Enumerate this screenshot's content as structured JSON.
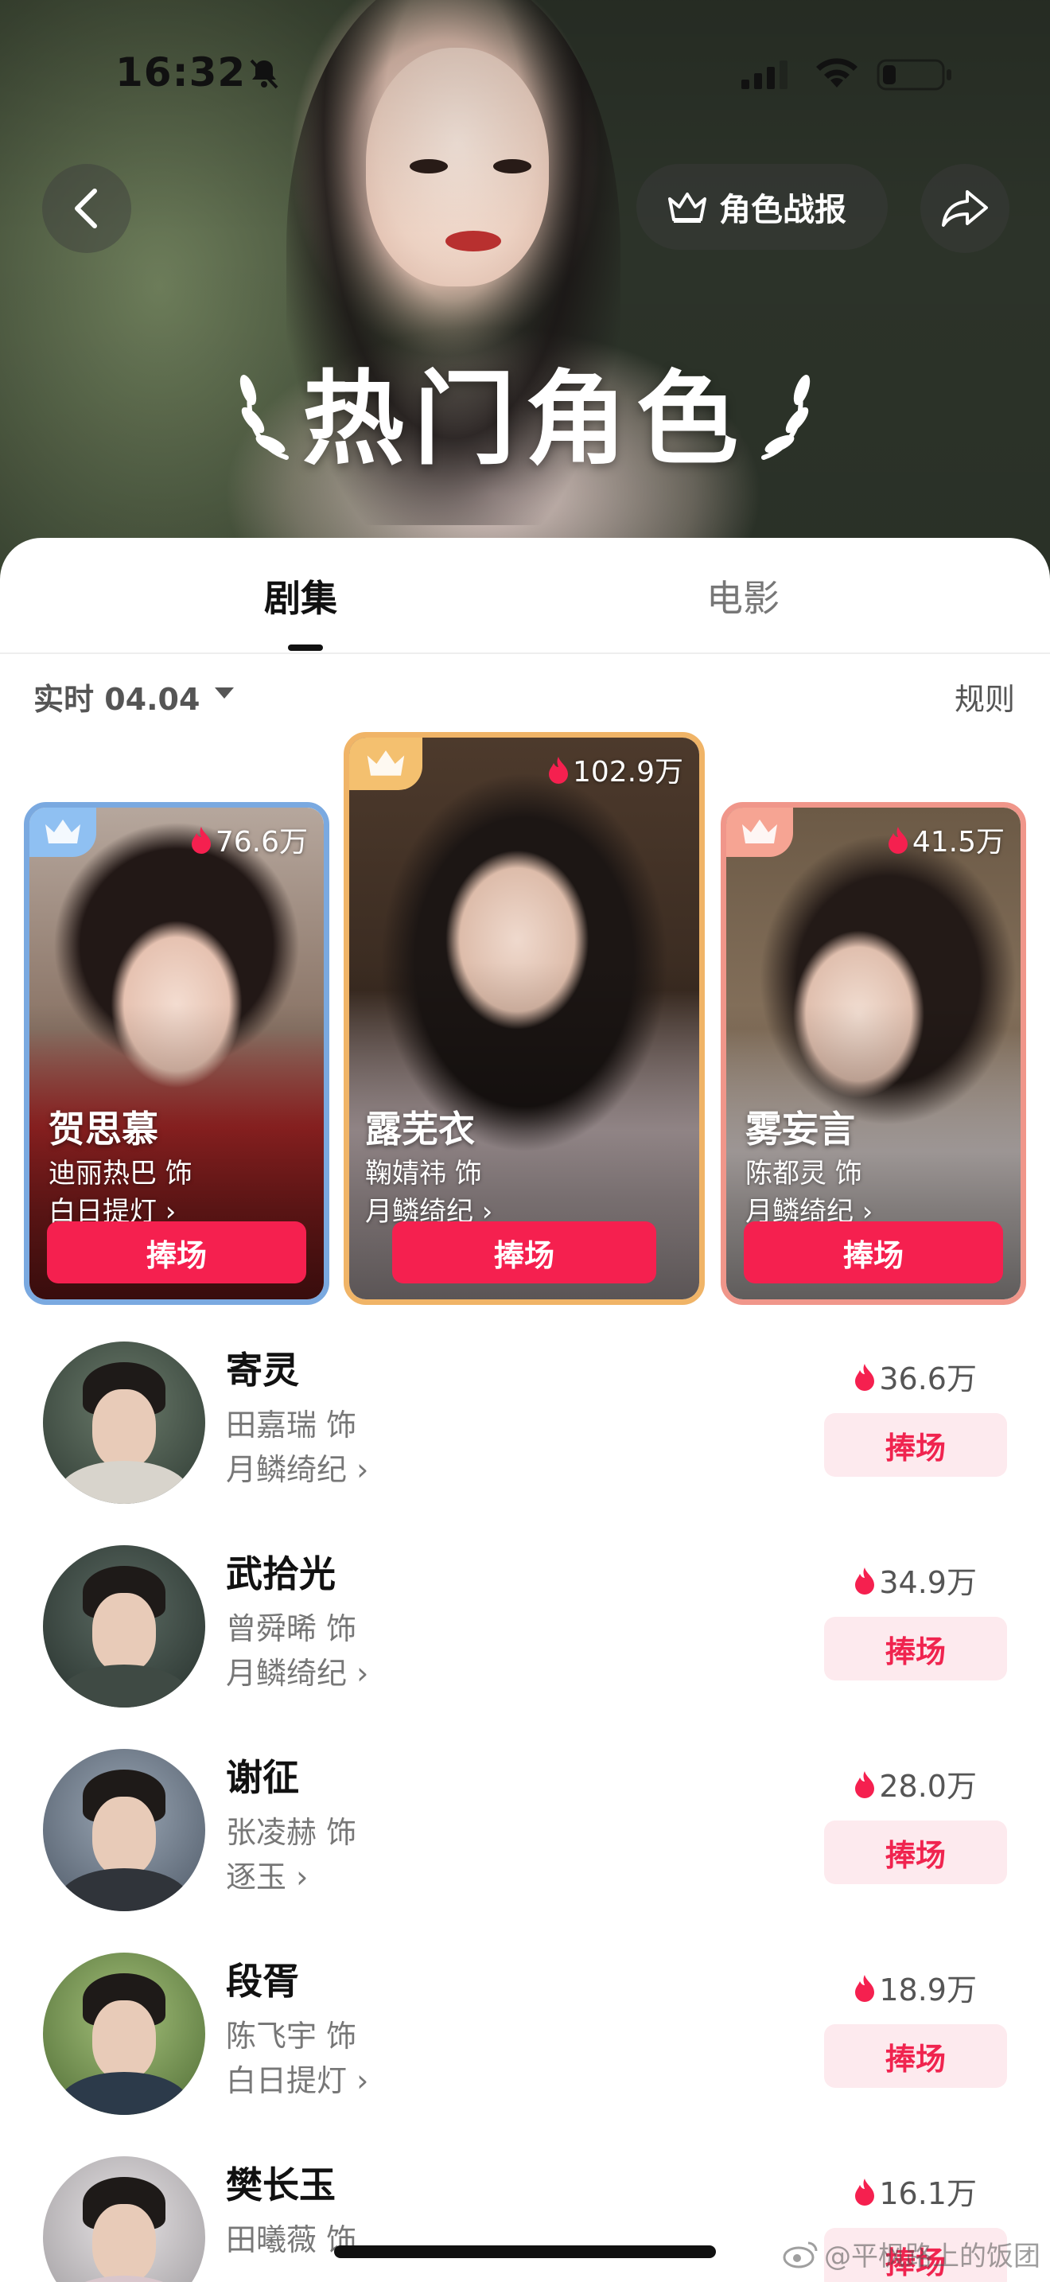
{
  "status_bar": {
    "time": "16:32"
  },
  "header": {
    "report_label": "角色战报",
    "title": "热门角色"
  },
  "tabs": [
    {
      "label": "剧集"
    },
    {
      "label": "电影"
    }
  ],
  "filter": {
    "label": "实时 04.04",
    "rules_label": "规则"
  },
  "colors": {
    "accent": "#f5204f",
    "support_bg": "#fdeaee",
    "rank1_border": "#f0b467",
    "rank2_border": "#7aa9e0",
    "rank3_border": "#f0968a"
  },
  "podium": [
    {
      "name": "贺思慕",
      "actor": "迪丽热巴 饰",
      "show": "白日提灯 ›",
      "heat": "76.6万",
      "support_label": "捧场"
    },
    {
      "name": "露芜衣",
      "actor": "鞠婧祎 饰",
      "show": "月鳞绮纪 ›",
      "heat": "102.9万",
      "support_label": "捧场"
    },
    {
      "name": "雾妄言",
      "actor": "陈都灵 饰",
      "show": "月鳞绮纪 ›",
      "heat": "41.5万",
      "support_label": "捧场"
    }
  ],
  "list": [
    {
      "name": "寄灵",
      "actor": "田嘉瑞 饰",
      "show": "月鳞绮纪 ›",
      "heat": "36.6万",
      "support_label": "捧场"
    },
    {
      "name": "武拾光",
      "actor": "曾舜晞 饰",
      "show": "月鳞绮纪 ›",
      "heat": "34.9万",
      "support_label": "捧场"
    },
    {
      "name": "谢征",
      "actor": "张凌赫 饰",
      "show": "逐玉 ›",
      "heat": "28.0万",
      "support_label": "捧场"
    },
    {
      "name": "段胥",
      "actor": "陈飞宇 饰",
      "show": "白日提灯 ›",
      "heat": "18.9万",
      "support_label": "捧场"
    },
    {
      "name": "樊长玉",
      "actor": "田曦薇 饰",
      "show": "",
      "heat": "16.1万",
      "support_label": "捧场"
    }
  ],
  "watermark": "@平枫路上的饭团"
}
